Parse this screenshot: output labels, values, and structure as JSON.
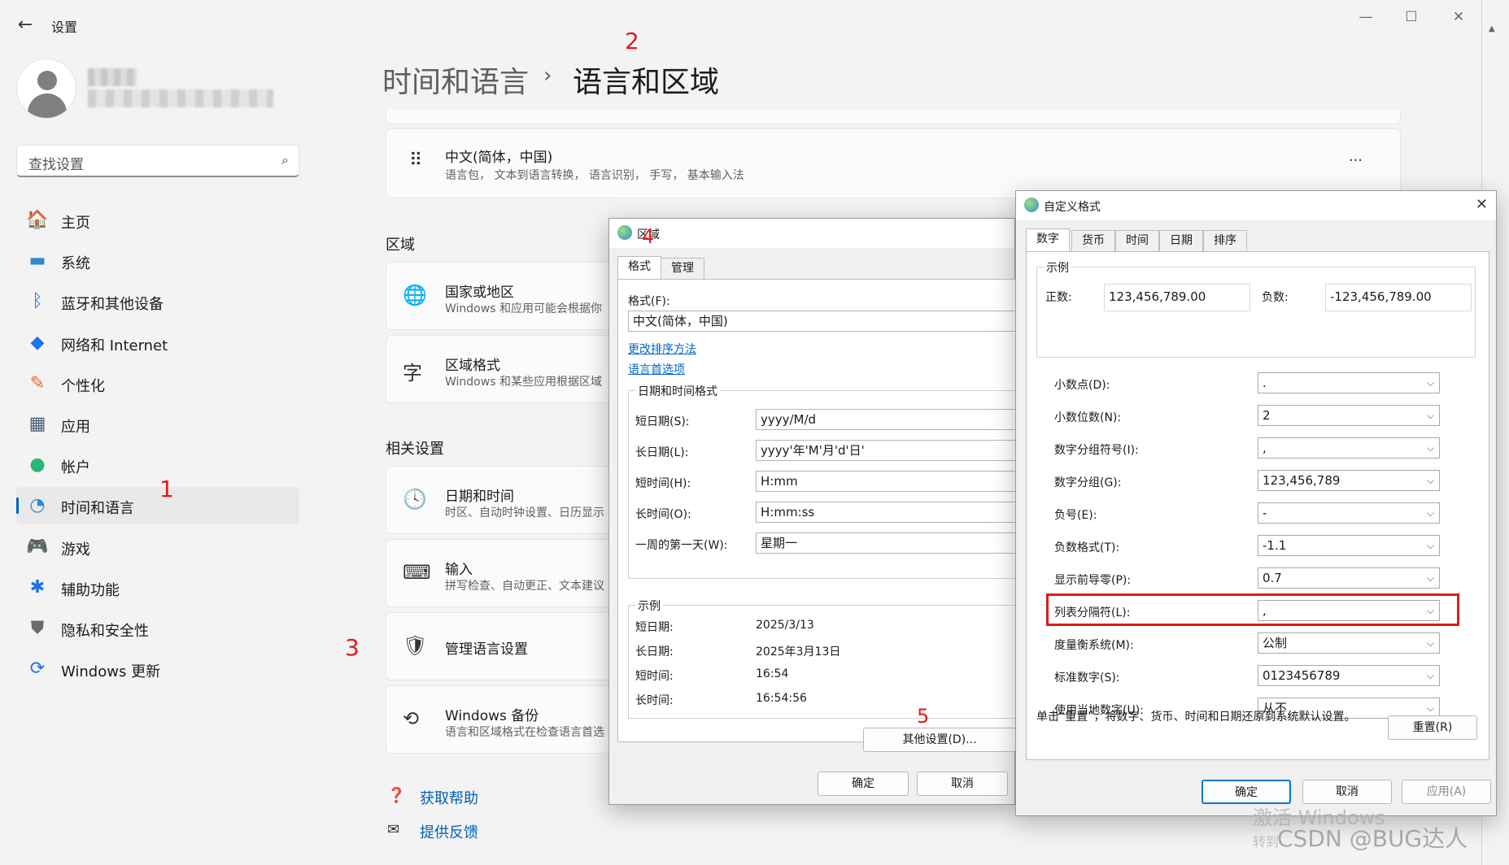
{
  "app": {
    "title": "设置",
    "back_icon": "back-arrow-icon"
  },
  "window_controls": [
    "minimize-icon",
    "maximize-icon",
    "close-icon"
  ],
  "user": {
    "avatar_icon": "user-avatar-icon"
  },
  "search": {
    "placeholder": "查找设置",
    "icon": "search-icon"
  },
  "nav": [
    {
      "label": "主页",
      "icon": "home-icon",
      "glyph": "🏠",
      "color": "#e06a2c"
    },
    {
      "label": "系统",
      "icon": "system-icon",
      "glyph": "▬",
      "color": "#2a8ad4"
    },
    {
      "label": "蓝牙和其他设备",
      "icon": "bluetooth-icon",
      "glyph": "ᛒ",
      "color": "#1a73e8"
    },
    {
      "label": "网络和 Internet",
      "icon": "wifi-icon",
      "glyph": "◆",
      "color": "#1a73e8"
    },
    {
      "label": "个性化",
      "icon": "brush-icon",
      "glyph": "✎",
      "color": "#e06a2c"
    },
    {
      "label": "应用",
      "icon": "apps-icon",
      "glyph": "▦",
      "color": "#4a5b7a"
    },
    {
      "label": "帐户",
      "icon": "account-icon",
      "glyph": "●",
      "color": "#2bb673"
    },
    {
      "label": "时间和语言",
      "icon": "time-language-icon",
      "glyph": "◔",
      "color": "#2a8ad4",
      "selected": true
    },
    {
      "label": "游戏",
      "icon": "game-controller-icon",
      "glyph": "🎮",
      "color": "#7a7a7a"
    },
    {
      "label": "辅助功能",
      "icon": "accessibility-icon",
      "glyph": "✱",
      "color": "#1a73e8"
    },
    {
      "label": "隐私和安全性",
      "icon": "shield-icon",
      "glyph": "⛊",
      "color": "#6b6b6b"
    },
    {
      "label": "Windows 更新",
      "icon": "update-icon",
      "glyph": "⟳",
      "color": "#1a73e8"
    }
  ],
  "breadcrumb": {
    "parent": "时间和语言",
    "separator": "›",
    "current": "语言和区域"
  },
  "language_card": {
    "title": "中文(简体，中国)",
    "subtitle": "语言包， 文本到语言转换， 语言识别， 手写， 基本输入法",
    "drag_icon": "drag-handle-icon",
    "more": "···"
  },
  "region_section": {
    "heading": "区域"
  },
  "region_cards": [
    {
      "title": "国家或地区",
      "subtitle": "Windows 和应用可能会根据你",
      "icon": "globe-icon",
      "glyph": "🌐"
    },
    {
      "title": "区域格式",
      "subtitle": "Windows 和某些应用根据区域",
      "icon": "regional-format-icon",
      "glyph": "字"
    }
  ],
  "related_section": {
    "heading": "相关设置"
  },
  "related_cards": [
    {
      "title": "日期和时间",
      "subtitle": "时区、自动时钟设置、日历显示",
      "icon": "calendar-clock-icon",
      "glyph": "🕓"
    },
    {
      "title": "输入",
      "subtitle": "拼写检查、自动更正、文本建议",
      "icon": "keyboard-icon",
      "glyph": "⌨"
    },
    {
      "title": "管理语言设置",
      "subtitle": "",
      "icon": "language-admin-icon",
      "glyph": "🛡"
    },
    {
      "title": "Windows 备份",
      "subtitle": "语言和区域格式在检查语言首选",
      "icon": "backup-icon",
      "glyph": "⟲"
    }
  ],
  "help_links": [
    {
      "label": "获取帮助",
      "icon": "help-icon",
      "glyph": "❓"
    },
    {
      "label": "提供反馈",
      "icon": "feedback-icon",
      "glyph": "✉"
    }
  ],
  "annotations": [
    "1",
    "2",
    "3",
    "4",
    "5"
  ],
  "region_dialog": {
    "title": "区域",
    "icon": "globe-region-icon",
    "tabs": [
      "格式",
      "管理"
    ],
    "format_label": "格式(F):",
    "format_value": "中文(简体，中国)",
    "links": [
      "更改排序方法",
      "语言首选项"
    ],
    "datetime_group": "日期和时间格式",
    "datetime_rows": [
      {
        "label": "短日期(S):",
        "value": "yyyy/M/d"
      },
      {
        "label": "长日期(L):",
        "value": "yyyy'年'M'月'd'日'"
      },
      {
        "label": "短时间(H):",
        "value": "H:mm"
      },
      {
        "label": "长时间(O):",
        "value": "H:mm:ss"
      },
      {
        "label": "一周的第一天(W):",
        "value": "星期一"
      }
    ],
    "example_group": "示例",
    "example_rows": [
      {
        "label": "短日期:",
        "value": "2025/3/13"
      },
      {
        "label": "长日期:",
        "value": "2025年3月13日"
      },
      {
        "label": "短时间:",
        "value": "16:54"
      },
      {
        "label": "长时间:",
        "value": "16:54:56"
      }
    ],
    "more_button": "其他设置(D)...",
    "ok": "确定",
    "cancel": "取消"
  },
  "custom_dialog": {
    "title": "自定义格式",
    "icon": "globe-custom-icon",
    "close_icon": "close-icon",
    "tabs": [
      "数字",
      "货币",
      "时间",
      "日期",
      "排序"
    ],
    "example_group": "示例",
    "positive_label": "正数:",
    "positive_value": "123,456,789.00",
    "negative_label": "负数:",
    "negative_value": "-123,456,789.00",
    "rows": [
      {
        "label": "小数点(D):",
        "value": "."
      },
      {
        "label": "小数位数(N):",
        "value": "2"
      },
      {
        "label": "数字分组符号(I):",
        "value": ","
      },
      {
        "label": "数字分组(G):",
        "value": "123,456,789"
      },
      {
        "label": "负号(E):",
        "value": "-"
      },
      {
        "label": "负数格式(T):",
        "value": "-1.1"
      },
      {
        "label": "显示前导零(P):",
        "value": "0.7"
      },
      {
        "label": "列表分隔符(L):",
        "value": ",",
        "highlight": true
      },
      {
        "label": "度量衡系统(M):",
        "value": "公制"
      },
      {
        "label": "标准数字(S):",
        "value": "0123456789"
      },
      {
        "label": "使用当地数字(U):",
        "value": "从不"
      }
    ],
    "reset_note": "单击“重置”，将数字、货币、时间和日期还原到系统默认设置。",
    "reset": "重置(R)",
    "ok": "确定",
    "cancel": "取消",
    "apply": "应用(A)"
  },
  "watermark": {
    "activate": "激活 Windows",
    "activate_sub": "转到",
    "credit": "CSDN @BUG达人"
  },
  "colors": {
    "accent": "#005fb8",
    "annotation": "#e21b1b"
  }
}
